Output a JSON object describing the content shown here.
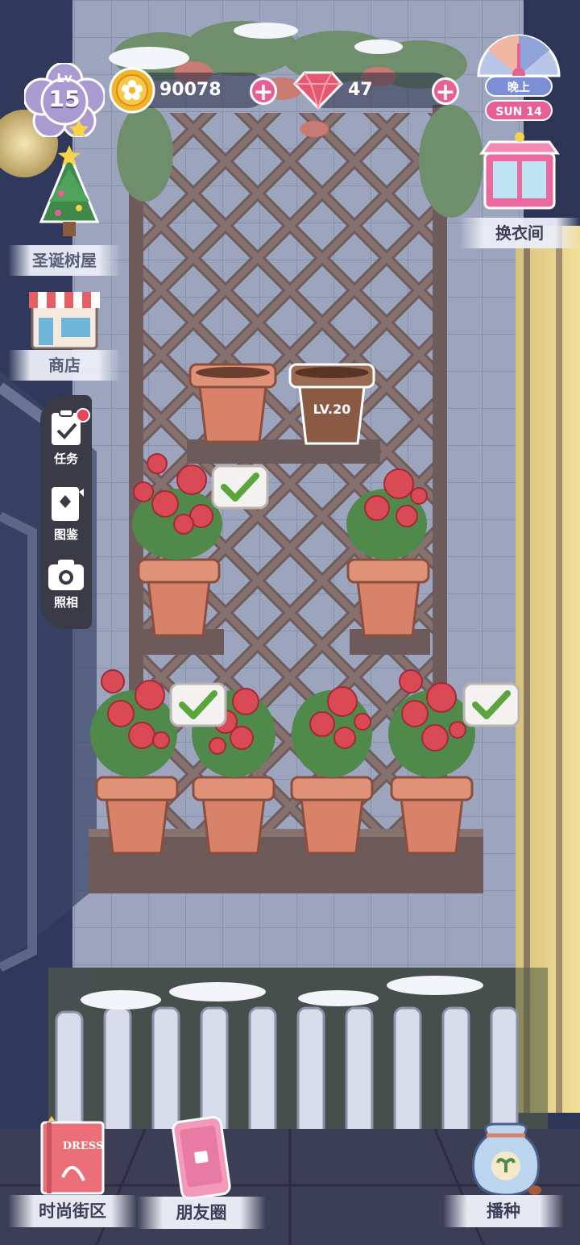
{
  "hud": {
    "level_prefix": "Lv",
    "level": "15",
    "coins": "90078",
    "gems": "47",
    "time_of_day": "晚上",
    "day": "SUN 14"
  },
  "left_menu": {
    "christmas_house": "圣诞树屋",
    "shop": "商店"
  },
  "tools": {
    "tasks": "任务",
    "catalog": "图鉴",
    "photo": "照相"
  },
  "right_menu": {
    "wardrobe": "换衣间"
  },
  "garden": {
    "locked_pot_level": "LV.20"
  },
  "bottom_bar": {
    "fashion_street": "时尚街区",
    "friends": "朋友圈",
    "sow": "播种"
  },
  "icons": {
    "dress_book_text": "DRESS"
  },
  "colors": {
    "accent_pink": "#e65f95",
    "pot_orange": "#d9826a",
    "check_green": "#5aa63c"
  }
}
